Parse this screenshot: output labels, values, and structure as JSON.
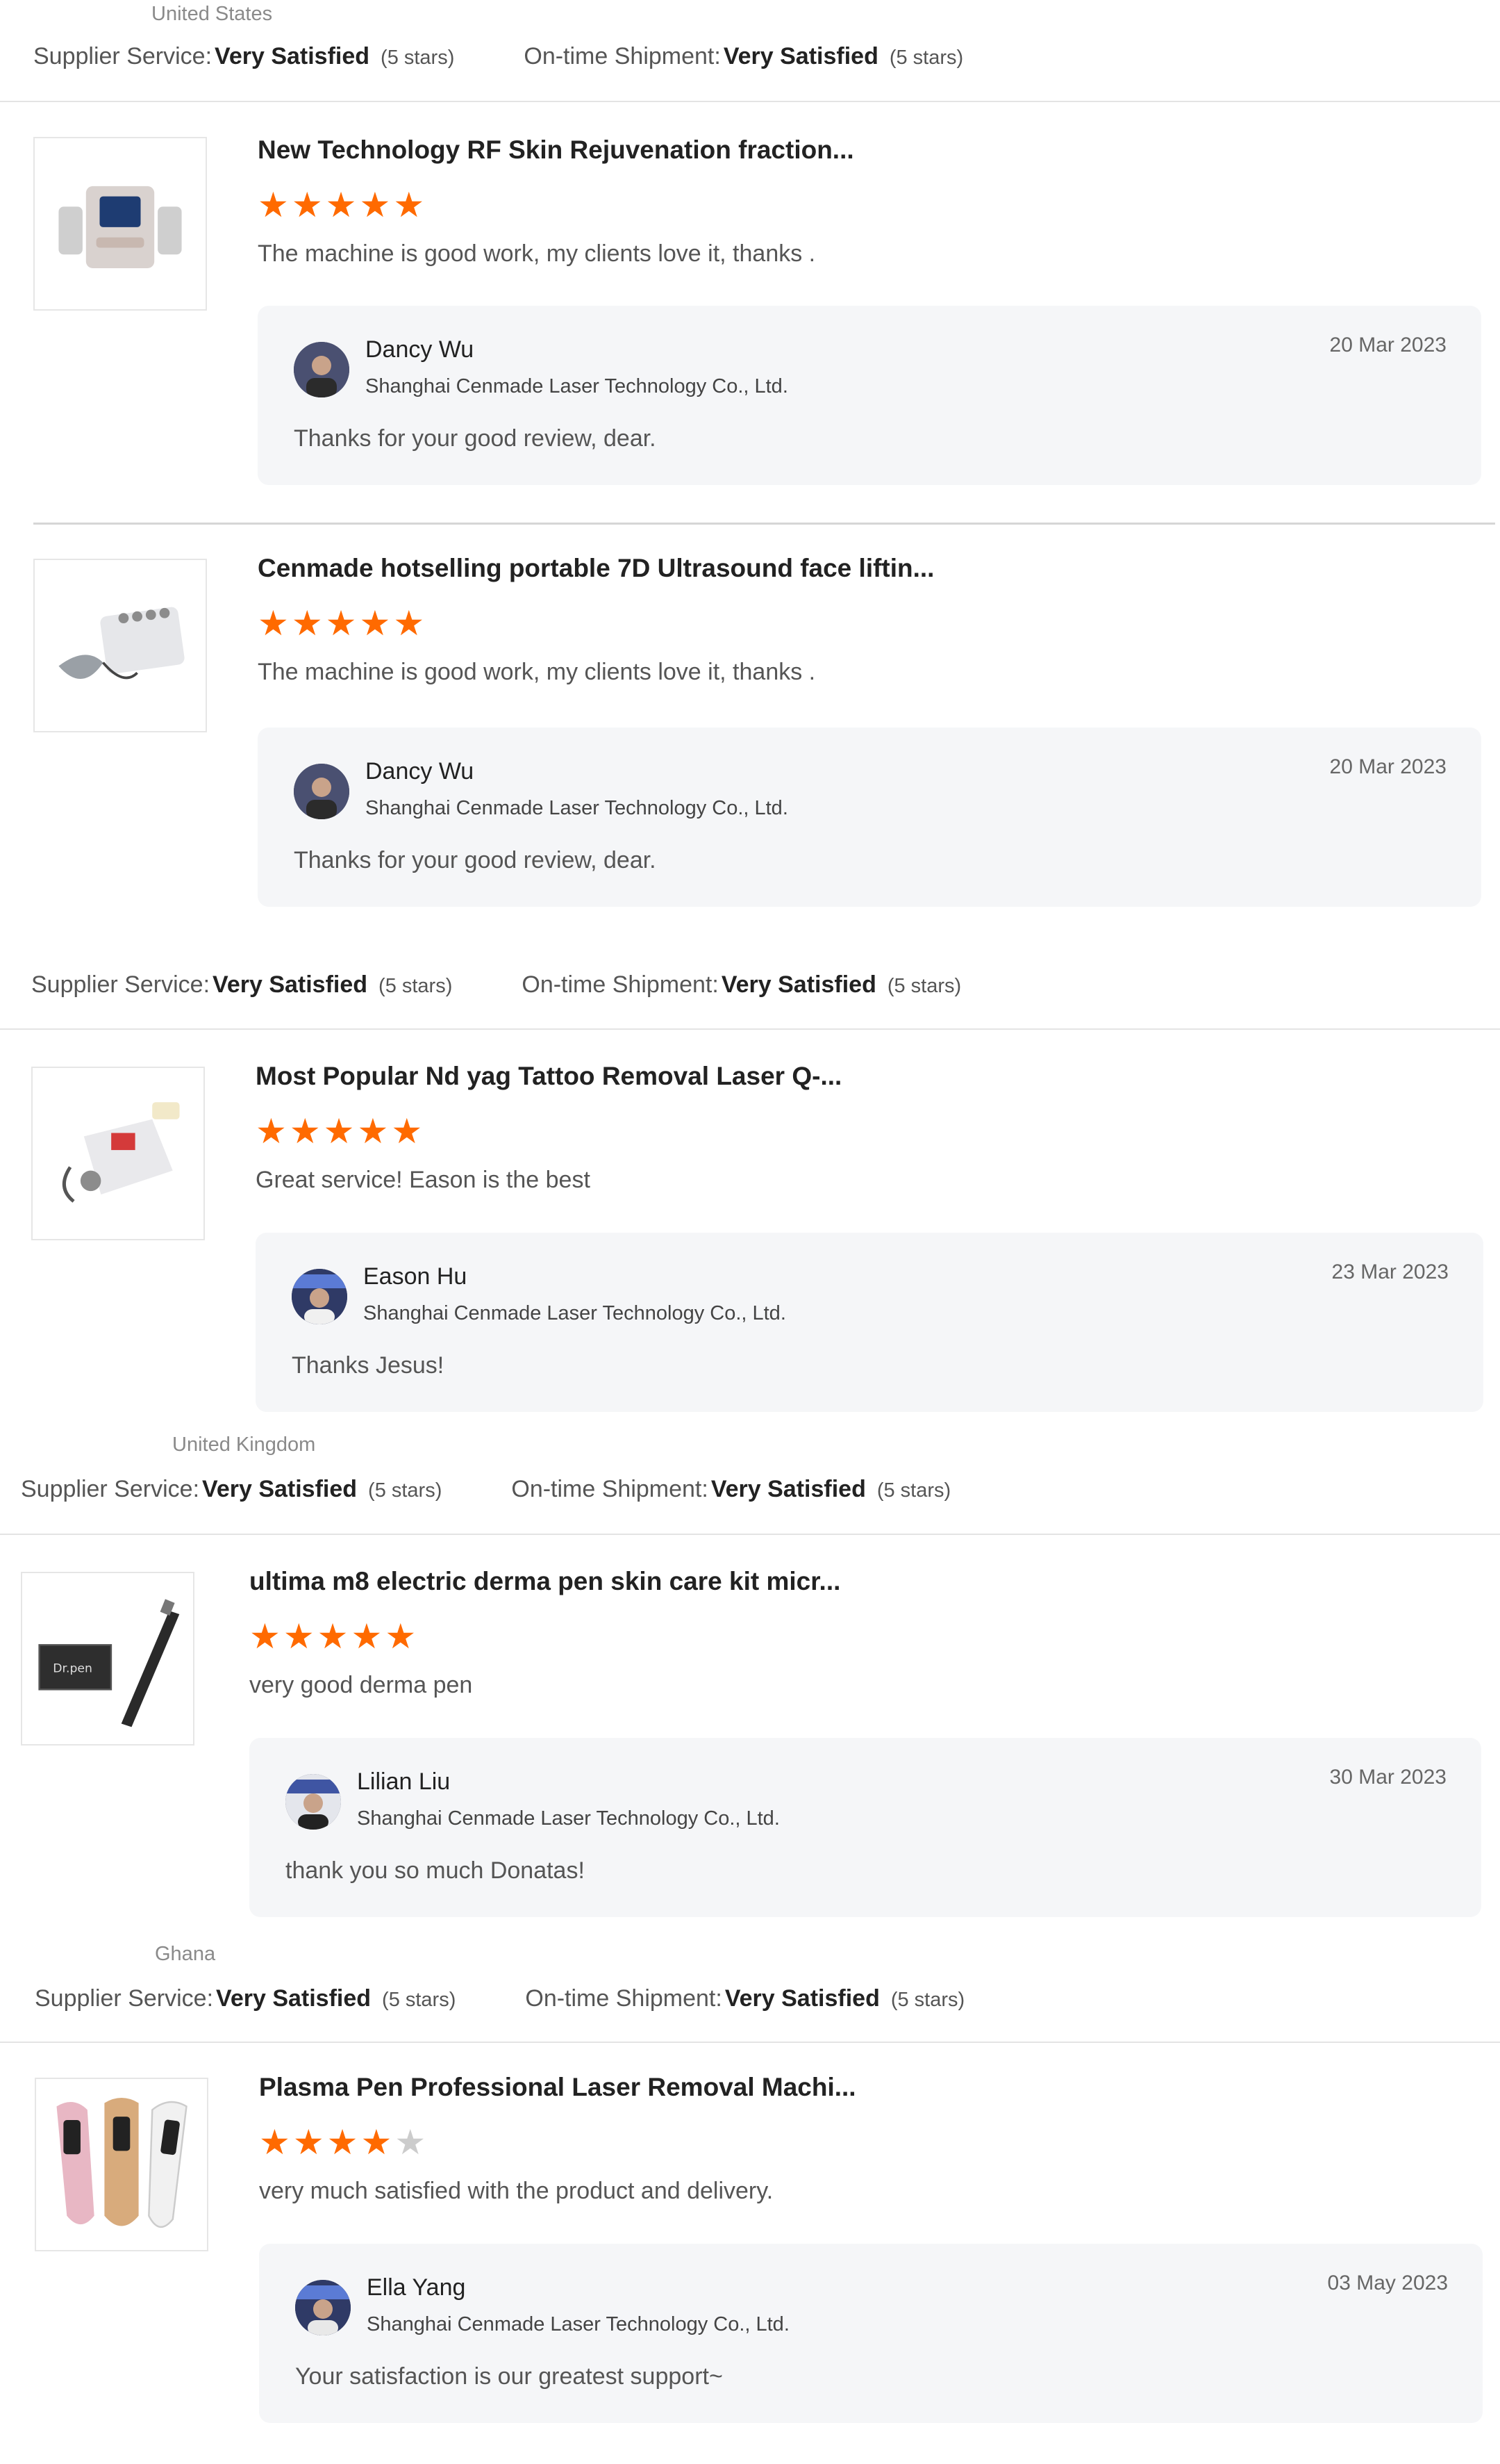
{
  "colors": {
    "star_on": "#ff6a00",
    "star_off": "#cccccc",
    "reply_bg": "#f5f6f8",
    "divider": "#e4e4e4"
  },
  "labels": {
    "supplier_service": "Supplier Service:",
    "ontime_shipment": "On-time Shipment:",
    "very_satisfied": "Very Satisfied",
    "five_stars": "(5 stars)"
  },
  "reviewer_headers": [
    {
      "country": "United States"
    },
    {
      "country": ""
    },
    {
      "country": "United Kingdom"
    },
    {
      "country": "Ghana"
    }
  ],
  "reviews": [
    {
      "product_title": "New Technology RF Skin Rejuvenation fraction...",
      "product_icon": "rf-machine-image",
      "rating": 5,
      "text": "The machine is good work, my clients love it, thanks .",
      "reply": {
        "name": "Dancy Wu",
        "company": "Shanghai Cenmade Laser Technology Co., Ltd.",
        "date": "20 Mar 2023",
        "text": "Thanks for your good review, dear."
      }
    },
    {
      "product_title": "Cenmade hotselling portable 7D Ultrasound face liftin...",
      "product_icon": "ultrasound-machine-image",
      "rating": 5,
      "text": "The machine is good work, my clients love it, thanks .",
      "reply": {
        "name": "Dancy Wu",
        "company": "Shanghai Cenmade Laser Technology Co., Ltd.",
        "date": "20 Mar 2023",
        "text": "Thanks for your good review, dear."
      }
    },
    {
      "product_title": "Most Popular Nd yag Tattoo Removal Laser Q-...",
      "product_icon": "laser-machine-image",
      "rating": 5,
      "text": "Great service! Eason is the best",
      "reply": {
        "name": "Eason Hu",
        "company": "Shanghai Cenmade Laser Technology Co., Ltd.",
        "date": "23 Mar 2023",
        "text": "Thanks Jesus!"
      }
    },
    {
      "product_title": "ultima m8 electric derma pen skin care kit micr...",
      "product_icon": "derma-pen-image",
      "rating": 5,
      "text": "very good derma pen",
      "reply": {
        "name": "Lilian Liu",
        "company": "Shanghai Cenmade Laser Technology Co., Ltd.",
        "date": "30 Mar 2023",
        "text": "thank you so much Donatas!"
      }
    },
    {
      "product_title": "Plasma Pen Professional Laser Removal Machi...",
      "product_icon": "plasma-pen-image",
      "rating": 4,
      "text": "very much satisfied with the product and delivery.",
      "reply": {
        "name": "Ella Yang",
        "company": "Shanghai Cenmade Laser Technology Co., Ltd.",
        "date": "03 May 2023",
        "text": "Your satisfaction is our greatest support~"
      }
    }
  ]
}
